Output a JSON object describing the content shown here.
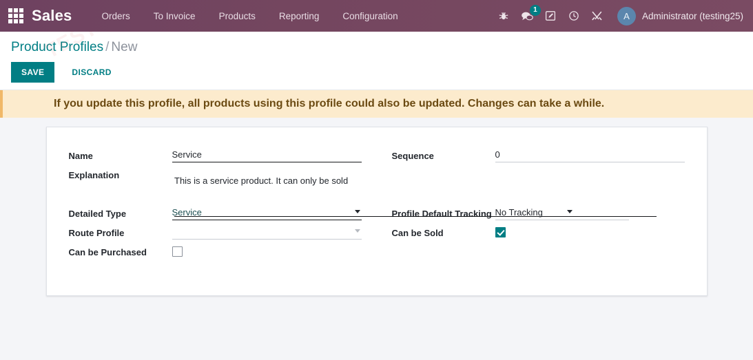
{
  "navbar": {
    "apps_icon": "apps-grid-icon",
    "brand": "Sales",
    "menus": [
      {
        "label": "Orders"
      },
      {
        "label": "To Invoice"
      },
      {
        "label": "Products"
      },
      {
        "label": "Reporting"
      },
      {
        "label": "Configuration"
      }
    ],
    "sys_icons": [
      {
        "name": "bug-icon"
      },
      {
        "name": "messages-icon",
        "badge": "1"
      },
      {
        "name": "edit-note-icon"
      },
      {
        "name": "clock-icon"
      },
      {
        "name": "tools-icon"
      }
    ],
    "user": {
      "avatar_initial": "A",
      "name": "Administrator (testing25)"
    }
  },
  "control_panel": {
    "breadcrumb": {
      "parent": "Product Profiles",
      "separator": "/",
      "current": "New"
    },
    "save_label": "SAVE",
    "discard_label": "DISCARD"
  },
  "alert": {
    "message": "If you update this profile, all products using this profile could also be updated. Changes can take a while."
  },
  "form": {
    "left": {
      "name": {
        "label": "Name",
        "value": "Service",
        "placeholder": ""
      },
      "explanation": {
        "label": "Explanation",
        "value": "This is a service product. It can only be sold",
        "placeholder": ""
      },
      "detailed_type": {
        "label": "Detailed Type",
        "value": "Service",
        "options": [
          "Service"
        ]
      },
      "route_profile": {
        "label": "Route Profile",
        "value": "",
        "placeholder": ""
      },
      "can_be_purchased": {
        "label": "Can be Purchased",
        "checked": false
      }
    },
    "right": {
      "sequence": {
        "label": "Sequence",
        "value": "0",
        "placeholder": ""
      },
      "profile_default_tracking": {
        "label": "Profile Default Tracking",
        "value": "No Tracking",
        "options": [
          "No Tracking"
        ]
      },
      "can_be_sold": {
        "label": "Can be Sold",
        "checked": true
      }
    }
  },
  "watermark": {
    "text": "TESTING"
  },
  "colors": {
    "navbar": "#71435f",
    "accent_teal": "#017e84",
    "alert_bg": "#fcebcd",
    "alert_text": "#6b4a12",
    "page_bg": "#f4f5f8",
    "avatar": "#5b86ad"
  }
}
